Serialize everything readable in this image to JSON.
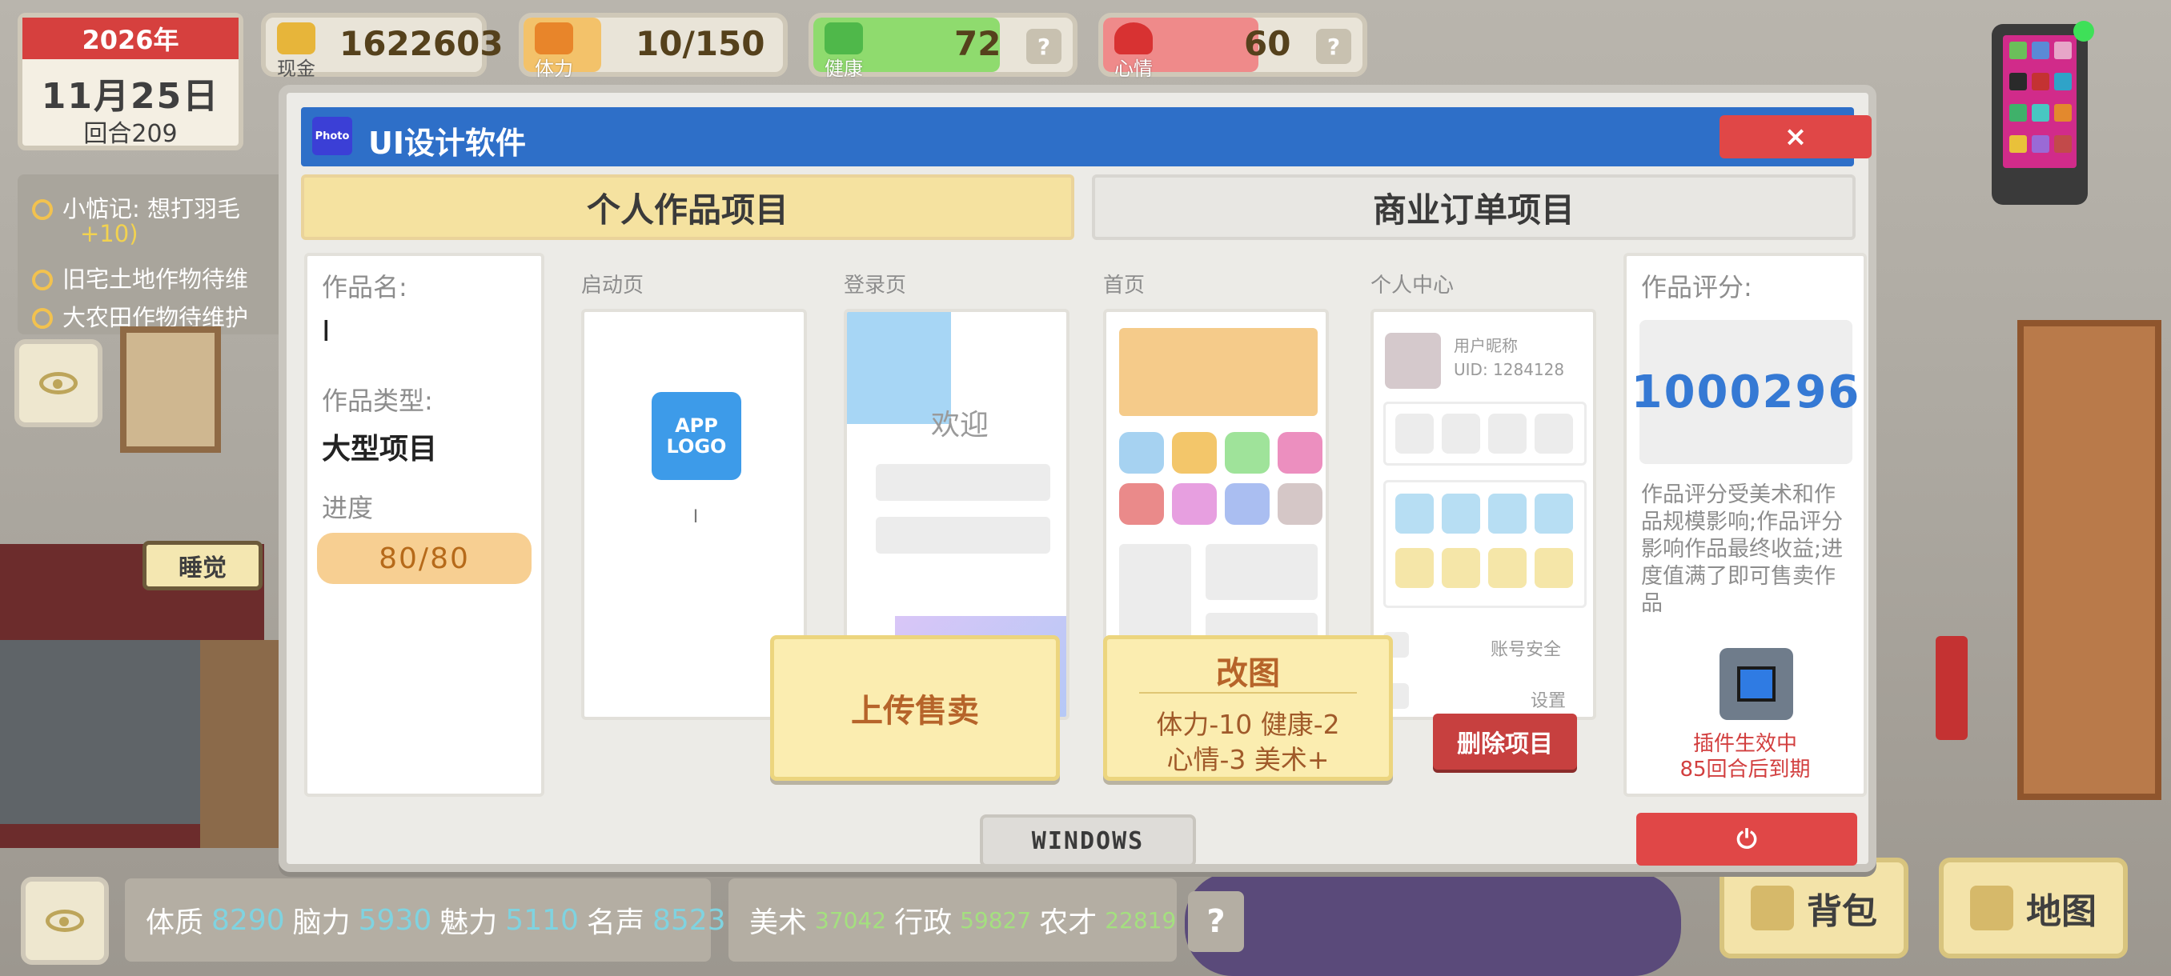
{
  "hud": {
    "date": {
      "year": "2026年",
      "day": "11月25日",
      "round": "回合209"
    },
    "cash": {
      "label": "现金",
      "value": "1622603"
    },
    "stamina": {
      "label": "体力",
      "value": "10/150",
      "fill_fraction": 0.07
    },
    "health": {
      "label": "健康",
      "value": "72",
      "help": "?",
      "fill_fraction": 0.72
    },
    "mood": {
      "label": "心情",
      "value": "60",
      "help": "?",
      "fill_fraction": 0.6
    }
  },
  "quests": [
    {
      "text": "小惦记: 想打羽毛"
    },
    {
      "text": "+10)"
    },
    {
      "text": "旧宅土地作物待维"
    },
    {
      "text": "大农田作物待维护"
    }
  ],
  "sleep_label": "睡觉",
  "dialog": {
    "title": "UI设计软件",
    "app_icon_text": "Photo",
    "close_label": "×",
    "tabs": {
      "personal": "个人作品项目",
      "business": "商业订单项目"
    },
    "work": {
      "name_label": "作品名:",
      "name_value": "I",
      "type_label": "作品类型:",
      "type_value": "大型项目",
      "progress_label": "进度",
      "progress_value": "80/80",
      "progress_fraction": 1.0
    },
    "screens": {
      "launch": {
        "label": "启动页",
        "logo_text": "APP LOGO",
        "caret": "I"
      },
      "login": {
        "label": "登录页",
        "welcome": "欢迎"
      },
      "home": {
        "label": "首页"
      },
      "profile": {
        "label": "个人中心",
        "nickname": "用户昵称",
        "uid": "UID: 1284128",
        "account_security": "账号安全",
        "settings": "设置"
      }
    },
    "upload_label": "上传售卖",
    "redraw": {
      "title": "改图",
      "cost_line1": "体力-10 健康-2",
      "cost_line2": "心情-3 美术+"
    },
    "delete_label": "删除项目",
    "score": {
      "label": "作品评分:",
      "value": "1000296",
      "note": "作品评分受美术和作品规模影响;作品评分影响作品最终收益;进度值满了即可售卖作品",
      "plugin_line1": "插件生效中",
      "plugin_line2": "85回合后到期"
    },
    "windows_label": "WINDOWS",
    "power_label": "⏻"
  },
  "attributes": {
    "physique_label": "体质",
    "physique": "8290",
    "brain_label": "脑力",
    "brain": "5930",
    "charm_label": "魅力",
    "charm": "5110",
    "fame_label": "名声",
    "fame": "8523",
    "art_label": "美术",
    "art": "37042",
    "admin_label": "行政",
    "admin": "59827",
    "farm_label": "农才",
    "farm": "22819",
    "help": "?"
  },
  "bag_label": "背包",
  "map_label": "地图",
  "colors": {
    "titlebar": "#2e6fc8",
    "close": "#e04747",
    "tab_active": "#f5e2a0",
    "score": "#3579d4",
    "plugin_text": "#d23f3f"
  }
}
